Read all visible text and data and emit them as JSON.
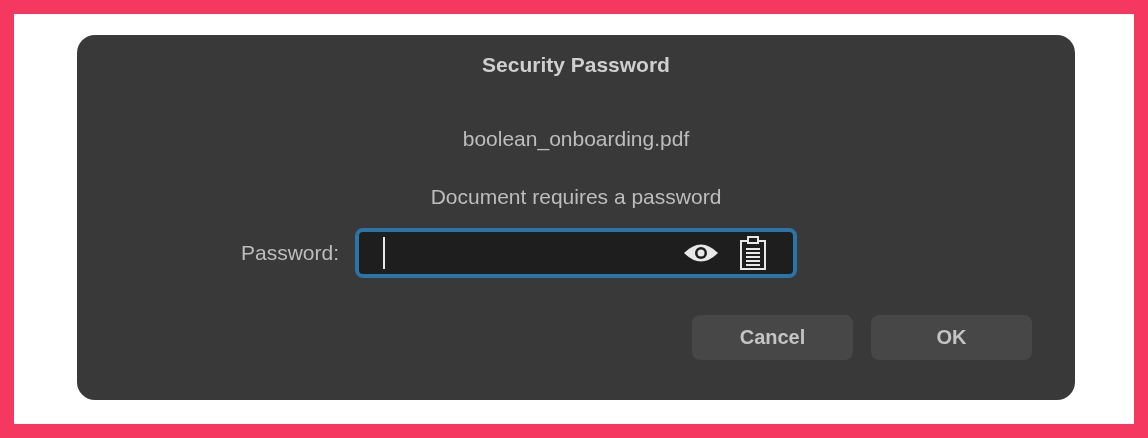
{
  "dialog": {
    "title": "Security Password",
    "filename": "boolean_onboarding.pdf",
    "message": "Document requires a password"
  },
  "password_field": {
    "label": "Password:",
    "focused": true
  },
  "buttons": [
    {
      "label": "Cancel"
    },
    {
      "label": "OK"
    }
  ]
}
